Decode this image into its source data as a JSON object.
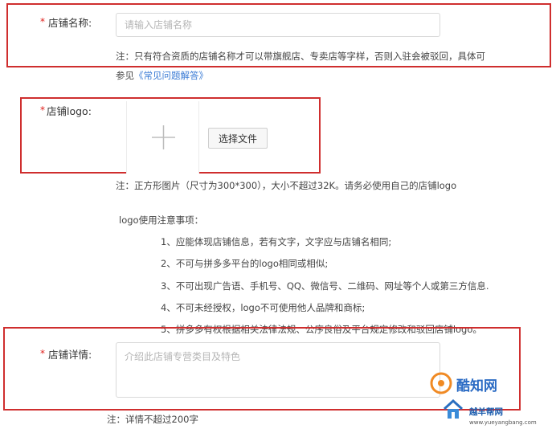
{
  "colors": {
    "highlight_border": "#cf2e2e",
    "required_mark": "#e0211c",
    "link": "#3a7bd5"
  },
  "store_name": {
    "required_mark": "*",
    "label": "店铺名称:",
    "placeholder": "请输入店铺名称",
    "value": "",
    "note_line1": "注：只有符合资质的店铺名称才可以带旗舰店、专卖店等字样，否则入驻会被驳回，具体可",
    "note_line2_prefix": "参见",
    "faq_link": "《常见问题解答》"
  },
  "store_logo": {
    "required_mark": "*",
    "label": "店铺logo:",
    "upload_icon": "plus-icon",
    "choose_file_button": "选择文件",
    "note": "注：正方形图片（尺寸为300*300），大小不超过32K。请务必使用自己的店铺logo",
    "rules_title": "logo使用注意事项：",
    "rules": [
      "1、应能体现店铺信息，若有文字，文字应与店铺名相同;",
      "2、不可与拼多多平台的logo相同或相似;",
      "3、不可出现广告语、手机号、QQ、微信号、二维码、网址等个人或第三方信息.",
      "4、不可未经授权，logo不可使用他人品牌和商标;",
      "5、拼多多有权根据相关法律法规、公序良俗及平台规定修改和驳回店铺logo。"
    ]
  },
  "store_detail": {
    "required_mark": "*",
    "label": "店铺详情:",
    "placeholder": "介绍此店铺专营类目及特色",
    "value": "",
    "note": "注：详情不超过200字"
  },
  "watermark": {
    "logo_text": "酷知网",
    "site_name": "越羊帮网",
    "url": "www.yueyangbang.com"
  }
}
